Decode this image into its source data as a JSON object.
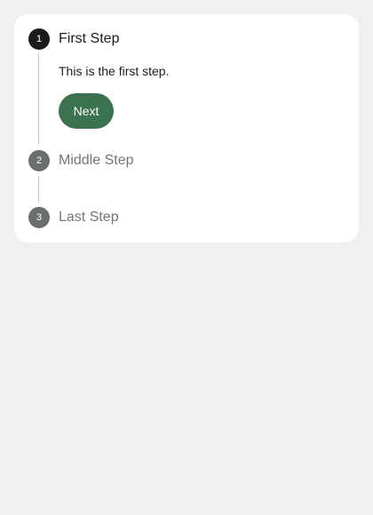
{
  "stepper": {
    "steps": [
      {
        "number": "1",
        "title": "First Step",
        "description": "This is the first step.",
        "action_label": "Next",
        "state": "active"
      },
      {
        "number": "2",
        "title": "Middle Step",
        "state": "inactive"
      },
      {
        "number": "3",
        "title": "Last Step",
        "state": "inactive"
      }
    ]
  },
  "colors": {
    "background": "#f0f0f0",
    "card": "#ffffff",
    "active_circle": "#1a1c1a",
    "inactive_circle": "#6b6f6b",
    "primary_button": "#3d7250",
    "connector": "#c4c7c4"
  }
}
